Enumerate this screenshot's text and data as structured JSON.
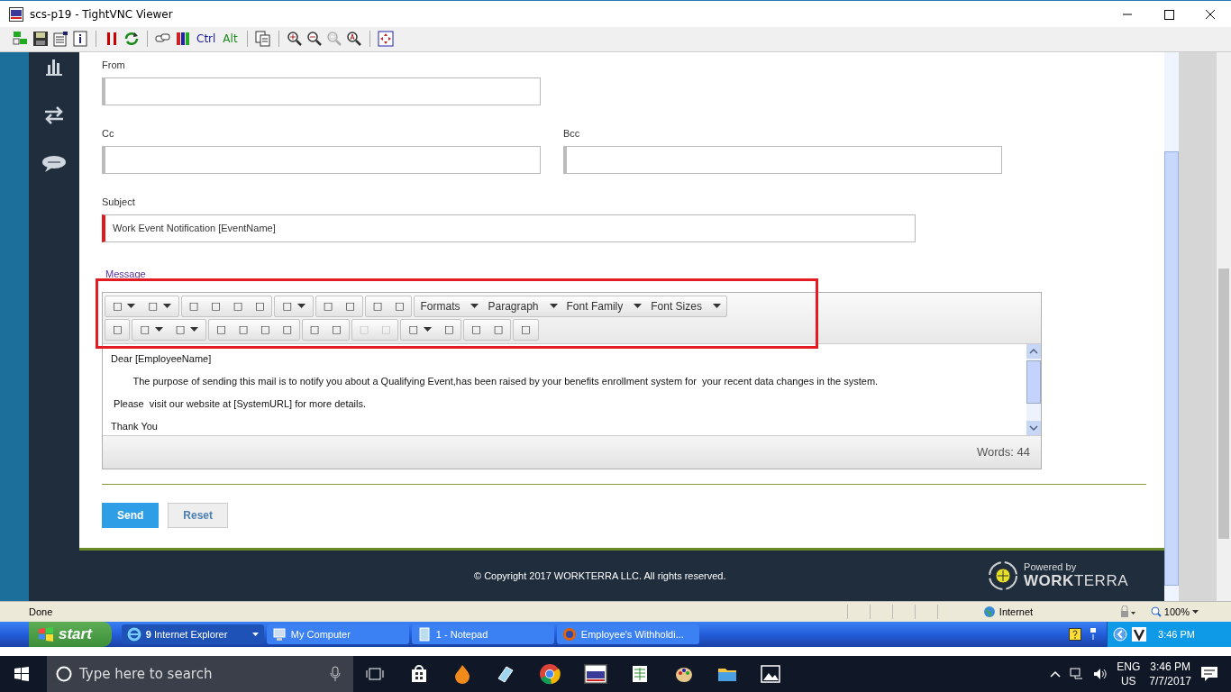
{
  "window": {
    "title": "scs-p19 - TightVNC Viewer"
  },
  "vnc_toolbar": [
    {
      "kind": "connections",
      "disabled": false
    },
    {
      "kind": "save",
      "disabled": false
    },
    {
      "kind": "options",
      "disabled": false
    },
    {
      "kind": "info",
      "disabled": false
    },
    {
      "kind": "sep"
    },
    {
      "kind": "pause",
      "disabled": false
    },
    {
      "kind": "refresh",
      "disabled": false
    },
    {
      "kind": "sep"
    },
    {
      "kind": "keys",
      "disabled": false
    },
    {
      "kind": "cad",
      "disabled": false
    },
    {
      "kind": "text",
      "label": "Ctrl",
      "color": "#1a1aa0",
      "disabled": false
    },
    {
      "kind": "text",
      "label": "Alt",
      "color": "#1a8a1a",
      "disabled": false
    },
    {
      "kind": "sep"
    },
    {
      "kind": "clipboard",
      "disabled": false
    },
    {
      "kind": "sep"
    },
    {
      "kind": "zoom-in",
      "disabled": false
    },
    {
      "kind": "zoom-out",
      "disabled": false
    },
    {
      "kind": "zoom-fit",
      "disabled": true
    },
    {
      "kind": "zoom-auto",
      "disabled": false
    },
    {
      "kind": "sep"
    },
    {
      "kind": "fullscreen",
      "disabled": false
    }
  ],
  "form": {
    "rows": [
      [
        {
          "label": "From",
          "error": false
        }
      ],
      [
        {
          "label": "Cc",
          "error": false
        },
        {
          "label": "Bcc",
          "error": false
        }
      ],
      [
        {
          "label": "Subject",
          "value": "Work Event Notification [EventName]",
          "error": true,
          "wide": true
        }
      ]
    ]
  },
  "editor": {
    "label": "Message",
    "toolbar_rows": [
      [
        [
          {
            "label": "□",
            "dropdown": true,
            "disabled": false
          },
          {
            "label": "□",
            "dropdown": true,
            "disabled": false
          }
        ],
        [
          {
            "label": "□",
            "dropdown": false,
            "disabled": false
          },
          {
            "label": "□",
            "dropdown": false,
            "disabled": false
          },
          {
            "label": "□",
            "dropdown": false,
            "disabled": false
          },
          {
            "label": "□",
            "dropdown": false,
            "disabled": false
          }
        ],
        [
          {
            "label": "□",
            "dropdown": true,
            "disabled": false
          }
        ],
        [
          {
            "label": "□",
            "dropdown": false,
            "disabled": false
          },
          {
            "label": "□",
            "dropdown": false,
            "disabled": false
          }
        ],
        [
          {
            "label": "□",
            "dropdown": false,
            "disabled": false
          },
          {
            "label": "□",
            "dropdown": false,
            "disabled": false
          }
        ],
        [
          {
            "label": "Formats",
            "dropdown": true,
            "disabled": false
          },
          {
            "label": "Paragraph",
            "dropdown": true,
            "disabled": false
          },
          {
            "label": "Font Family",
            "dropdown": true,
            "disabled": false
          },
          {
            "label": "Font Sizes",
            "dropdown": true,
            "disabled": false
          }
        ]
      ],
      [
        [
          {
            "label": "□",
            "dropdown": false,
            "disabled": false
          }
        ],
        [
          {
            "label": "□",
            "dropdown": true,
            "disabled": false
          },
          {
            "label": "□",
            "dropdown": true,
            "disabled": false
          }
        ],
        [
          {
            "label": "□",
            "dropdown": false,
            "disabled": false
          },
          {
            "label": "□",
            "dropdown": false,
            "disabled": false
          },
          {
            "label": "□",
            "dropdown": false,
            "disabled": false
          },
          {
            "label": "□",
            "dropdown": false,
            "disabled": false
          }
        ],
        [
          {
            "label": "□",
            "dropdown": false,
            "disabled": false
          },
          {
            "label": "□",
            "dropdown": false,
            "disabled": false
          }
        ],
        [
          {
            "label": "□",
            "dropdown": false,
            "disabled": true
          },
          {
            "label": "□",
            "dropdown": false,
            "disabled": true
          }
        ],
        [
          {
            "label": "□",
            "dropdown": true,
            "disabled": false
          },
          {
            "label": "□",
            "dropdown": false,
            "disabled": false
          }
        ],
        [
          {
            "label": "□",
            "dropdown": false,
            "disabled": false
          },
          {
            "label": "□",
            "dropdown": false,
            "disabled": false
          }
        ],
        [
          {
            "label": "□",
            "dropdown": false,
            "disabled": false
          }
        ]
      ]
    ],
    "body": [
      "Dear [EmployeeName]",
      "        The purpose of sending this mail is to notify you about a Qualifying Event,has been raised by your benefits enrollment system for  your recent data changes in the system.",
      " Please  visit our website at [SystemURL] for more details.",
      "Thank You"
    ],
    "word_count": "Words: 44"
  },
  "buttons": [
    {
      "label": "Send",
      "kind": "primary"
    },
    {
      "label": "Reset",
      "kind": "secondary"
    }
  ],
  "footer": {
    "copyright": "© Copyright 2017 WORKTERRA LLC. All rights reserved.",
    "powered_by": "Powered by",
    "brand": "**WORK**TERRA"
  },
  "ie_status": {
    "status": "Done",
    "zone": "Internet",
    "zoom": "100%"
  },
  "xp_taskbar": {
    "start": "start",
    "items": [
      {
        "label": "**9** Internet Explorer",
        "kind": "ie",
        "dropdown": true
      },
      {
        "label": "My Computer",
        "kind": "computer",
        "dropdown": false
      },
      {
        "label": "1 - Notepad",
        "kind": "notepad",
        "dropdown": false
      },
      {
        "label": "Employee's Withholdi...",
        "kind": "firefox",
        "dropdown": false
      }
    ],
    "clock": "3:46 PM"
  },
  "win_taskbar": {
    "search_placeholder": "Type here to search",
    "lang": "ENG",
    "region": "US",
    "time": "3:46 PM",
    "date": "7/7/2017"
  }
}
